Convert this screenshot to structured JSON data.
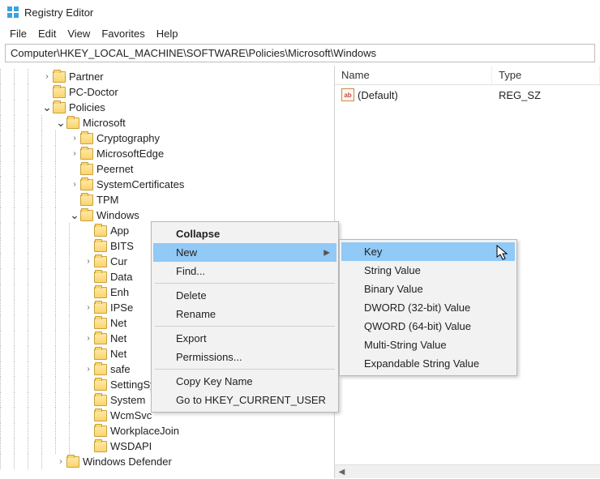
{
  "titlebar": {
    "title": "Registry Editor"
  },
  "menubar": [
    "File",
    "Edit",
    "View",
    "Favorites",
    "Help"
  ],
  "address": "Computer\\HKEY_LOCAL_MACHINE\\SOFTWARE\\Policies\\Microsoft\\Windows",
  "tree": [
    {
      "depth": 3,
      "twisty": ">",
      "label": "Partner"
    },
    {
      "depth": 3,
      "twisty": "",
      "label": "PC-Doctor"
    },
    {
      "depth": 3,
      "twisty": "v",
      "label": "Policies"
    },
    {
      "depth": 4,
      "twisty": "v",
      "label": "Microsoft"
    },
    {
      "depth": 5,
      "twisty": ">",
      "label": "Cryptography"
    },
    {
      "depth": 5,
      "twisty": ">",
      "label": "MicrosoftEdge"
    },
    {
      "depth": 5,
      "twisty": "",
      "label": "Peernet"
    },
    {
      "depth": 5,
      "twisty": ">",
      "label": "SystemCertificates"
    },
    {
      "depth": 5,
      "twisty": "",
      "label": "TPM"
    },
    {
      "depth": 5,
      "twisty": "v",
      "label": "Windows",
      "selected": true
    },
    {
      "depth": 6,
      "twisty": "",
      "label": "App"
    },
    {
      "depth": 6,
      "twisty": "",
      "label": "BITS"
    },
    {
      "depth": 6,
      "twisty": ">",
      "label": "Cur"
    },
    {
      "depth": 6,
      "twisty": "",
      "label": "Data"
    },
    {
      "depth": 6,
      "twisty": "",
      "label": "Enh"
    },
    {
      "depth": 6,
      "twisty": ">",
      "label": "IPSe"
    },
    {
      "depth": 6,
      "twisty": "",
      "label": "Net"
    },
    {
      "depth": 6,
      "twisty": ">",
      "label": "Net"
    },
    {
      "depth": 6,
      "twisty": "",
      "label": "Net"
    },
    {
      "depth": 6,
      "twisty": ">",
      "label": "safe"
    },
    {
      "depth": 6,
      "twisty": "",
      "label": "SettingSync"
    },
    {
      "depth": 6,
      "twisty": "",
      "label": "System"
    },
    {
      "depth": 6,
      "twisty": "",
      "label": "WcmSvc"
    },
    {
      "depth": 6,
      "twisty": "",
      "label": "WorkplaceJoin"
    },
    {
      "depth": 6,
      "twisty": "",
      "label": "WSDAPI"
    },
    {
      "depth": 4,
      "twisty": ">",
      "label": "Windows Defender"
    }
  ],
  "list": {
    "columns": {
      "name": "Name",
      "type": "Type"
    },
    "rows": [
      {
        "name": "(Default)",
        "type": "REG_SZ",
        "icon": "ab"
      }
    ]
  },
  "context_menu": {
    "items": [
      {
        "label": "Collapse",
        "bold": true
      },
      {
        "label": "New",
        "highlight": true,
        "submenu": true
      },
      {
        "label": "Find..."
      },
      {
        "sep": true
      },
      {
        "label": "Delete"
      },
      {
        "label": "Rename"
      },
      {
        "sep": true
      },
      {
        "label": "Export"
      },
      {
        "label": "Permissions..."
      },
      {
        "sep": true
      },
      {
        "label": "Copy Key Name"
      },
      {
        "label": "Go to HKEY_CURRENT_USER"
      }
    ]
  },
  "submenu": {
    "items": [
      {
        "label": "Key",
        "highlight": true
      },
      {
        "sep": true
      },
      {
        "label": "String Value"
      },
      {
        "label": "Binary Value"
      },
      {
        "label": "DWORD (32-bit) Value"
      },
      {
        "label": "QWORD (64-bit) Value"
      },
      {
        "label": "Multi-String Value"
      },
      {
        "label": "Expandable String Value"
      }
    ]
  }
}
